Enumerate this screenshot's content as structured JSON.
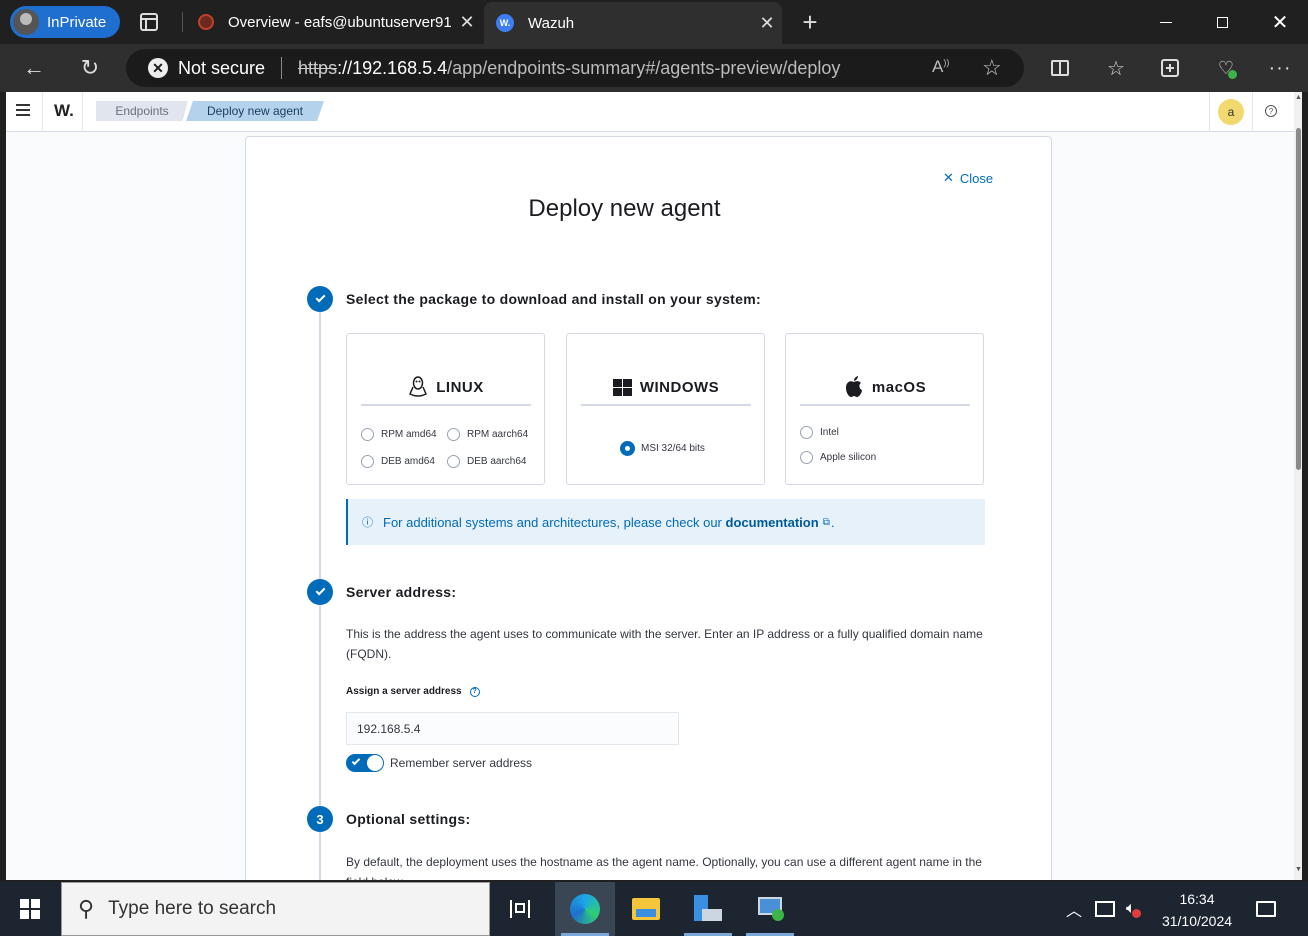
{
  "browser": {
    "inprivate_label": "InPrivate",
    "tabs": [
      {
        "title": "Overview - eafs@ubuntuserver91",
        "favicon": "ubuntu-icon",
        "active": false
      },
      {
        "title": "Wazuh",
        "favicon": "wazuh-icon",
        "active": true
      }
    ],
    "security_label": "Not secure",
    "url_scheme": "https",
    "url_host": "://192.168.5.4",
    "url_path": "/app/endpoints-summary#/agents-preview/deploy"
  },
  "app": {
    "logo": "W.",
    "breadcrumb": [
      "Endpoints",
      "Deploy new agent"
    ],
    "user_initial": "a"
  },
  "deploy": {
    "close_label": "Close",
    "title": "Deploy new agent",
    "step1": {
      "title": "Select the package to download and install on your system:",
      "linux": {
        "label": "LINUX",
        "options": [
          "RPM amd64",
          "RPM aarch64",
          "DEB amd64",
          "DEB aarch64"
        ]
      },
      "windows": {
        "label": "WINDOWS",
        "options": [
          "MSI 32/64 bits"
        ],
        "selected": "MSI 32/64 bits"
      },
      "macos": {
        "label": "macOS",
        "options": [
          "Intel",
          "Apple silicon"
        ]
      },
      "callout_text": "For additional systems and architectures, please check our",
      "callout_link": "documentation",
      "callout_end": "."
    },
    "step2": {
      "title": "Server address:",
      "description": "This is the address the agent uses to communicate with the server. Enter an IP address or a fully qualified domain name (FQDN).",
      "field_label": "Assign a server address",
      "server_address": "192.168.5.4",
      "remember_label": "Remember server address",
      "remember_on": true
    },
    "step3": {
      "number": "3",
      "title": "Optional settings:",
      "description": "By default, the deployment uses the hostname as the agent name. Optionally, you can use a different agent name in the field below."
    }
  },
  "taskbar": {
    "search_placeholder": "Type here to search",
    "time": "16:34",
    "date": "31/10/2024"
  },
  "colors": {
    "accent": "#006bb8",
    "callout_bg": "#e6f1fa",
    "taskbar": "#1c2530"
  }
}
